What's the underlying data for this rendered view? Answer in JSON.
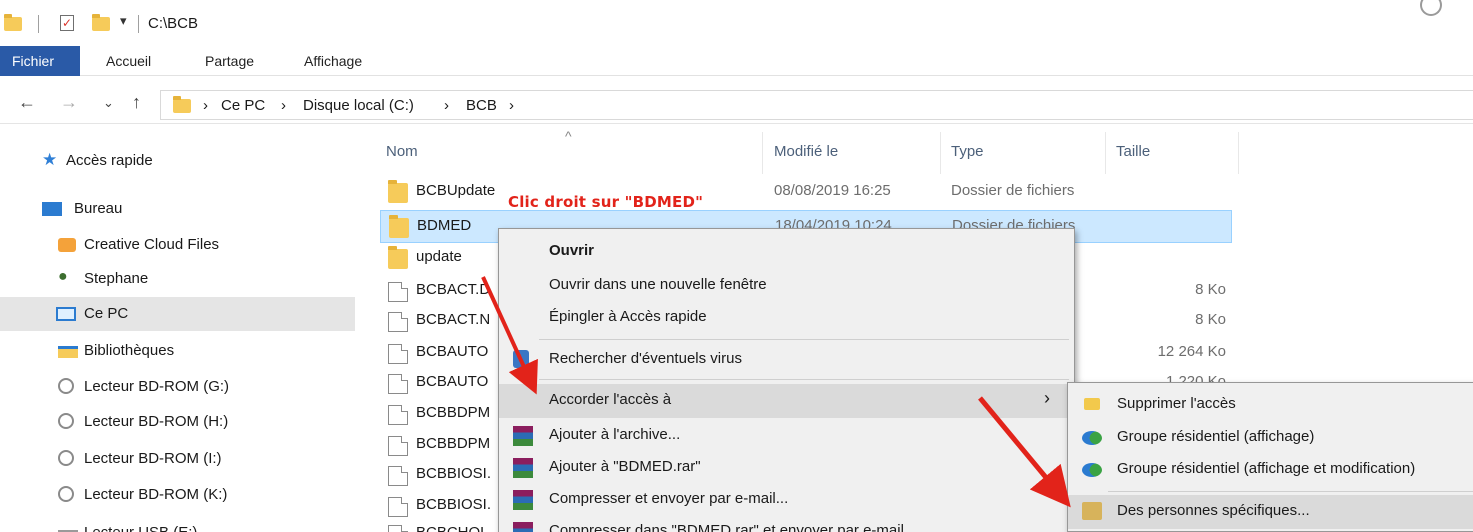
{
  "window": {
    "path": "C:\\BCB"
  },
  "ribbon": {
    "tabs": [
      "Fichier",
      "Accueil",
      "Partage",
      "Affichage"
    ]
  },
  "address": {
    "crumbs": [
      "Ce PC",
      "Disque local (C:)",
      "BCB"
    ]
  },
  "sidebar": {
    "items": [
      {
        "label": "Accès rapide",
        "icon": "star-icon"
      },
      {
        "label": "Bureau",
        "icon": "desktop-icon"
      },
      {
        "label": "Creative Cloud Files",
        "icon": "creative-cloud-icon"
      },
      {
        "label": "Stephane",
        "icon": "user-icon"
      },
      {
        "label": "Ce PC",
        "icon": "computer-icon",
        "selected": true
      },
      {
        "label": "Bibliothèques",
        "icon": "libraries-icon"
      },
      {
        "label": "Lecteur BD-ROM (G:)",
        "icon": "disc-drive-icon"
      },
      {
        "label": "Lecteur BD-ROM (H:)",
        "icon": "disc-drive-icon"
      },
      {
        "label": "Lecteur BD-ROM (I:)",
        "icon": "disc-drive-icon"
      },
      {
        "label": "Lecteur BD-ROM (K:)",
        "icon": "disc-drive-icon"
      },
      {
        "label": "Lecteur USB (E:)",
        "icon": "usb-drive-icon"
      }
    ]
  },
  "list": {
    "columns": {
      "name": "Nom",
      "modified": "Modifié le",
      "type": "Type",
      "size": "Taille"
    },
    "rows": [
      {
        "name": "BCBUpdate",
        "date": "08/08/2019 16:25",
        "type": "Dossier de fichiers",
        "size": "",
        "kind": "folder"
      },
      {
        "name": "BDMED",
        "date": "18/04/2019 10:24",
        "type": "Dossier de fichiers",
        "size": "",
        "kind": "folder",
        "selected": true
      },
      {
        "name": "update",
        "date": "",
        "type": "Dossier de fichiers",
        "size": "",
        "kind": "folder"
      },
      {
        "name": "BCBACT.D",
        "date": "",
        "type": "",
        "size": "8 Ko",
        "kind": "file"
      },
      {
        "name": "BCBACT.N",
        "date": "",
        "type": "",
        "size": "8 Ko",
        "kind": "file"
      },
      {
        "name": "BCBAUTO",
        "date": "",
        "type": "",
        "size": "12 264 Ko",
        "kind": "file"
      },
      {
        "name": "BCBAUTO",
        "date": "",
        "type": "",
        "size": "1 220 Ko",
        "kind": "file"
      },
      {
        "name": "BCBBDPM",
        "date": "",
        "type": "",
        "size": "",
        "kind": "file"
      },
      {
        "name": "BCBBDPM",
        "date": "",
        "type": "",
        "size": "",
        "kind": "file"
      },
      {
        "name": "BCBBIOSI.",
        "date": "",
        "type": "",
        "size": "",
        "kind": "file"
      },
      {
        "name": "BCBBIOSI.",
        "date": "",
        "type": "",
        "size": "",
        "kind": "file"
      },
      {
        "name": "BCBCHOL",
        "date": "",
        "type": "",
        "size": "",
        "kind": "file"
      }
    ]
  },
  "annotation": {
    "text": "Clic droit sur \"BDMED\"",
    "color": "#e2231a"
  },
  "context_menu": {
    "items": [
      {
        "label": "Ouvrir",
        "bold": true
      },
      {
        "label": "Ouvrir dans une nouvelle fenêtre"
      },
      {
        "label": "Épingler à Accès rapide"
      },
      {
        "label": "Rechercher d'éventuels virus",
        "icon": "defender-icon"
      },
      {
        "label": "Accorder l'accès à",
        "submenu": true,
        "highlighted": true
      },
      {
        "label": "Ajouter à l'archive...",
        "icon": "winrar-icon"
      },
      {
        "label": "Ajouter à \"BDMED.rar\"",
        "icon": "winrar-icon"
      },
      {
        "label": "Compresser et envoyer par e-mail...",
        "icon": "winrar-icon"
      },
      {
        "label": "Compresser dans \"BDMED.rar\" et envoyer par e-mail",
        "icon": "winrar-icon"
      }
    ]
  },
  "submenu": {
    "items": [
      {
        "label": "Supprimer l'accès",
        "icon": "lock-icon"
      },
      {
        "label": "Groupe résidentiel (affichage)",
        "icon": "homegroup-icon"
      },
      {
        "label": "Groupe résidentiel (affichage et modification)",
        "icon": "homegroup-icon"
      },
      {
        "label": "Des personnes spécifiques...",
        "icon": "people-icon",
        "highlighted": true
      }
    ]
  },
  "colors": {
    "accent": "#2a5aa7",
    "selection": "#cce8ff",
    "arrow": "#e2231a"
  }
}
